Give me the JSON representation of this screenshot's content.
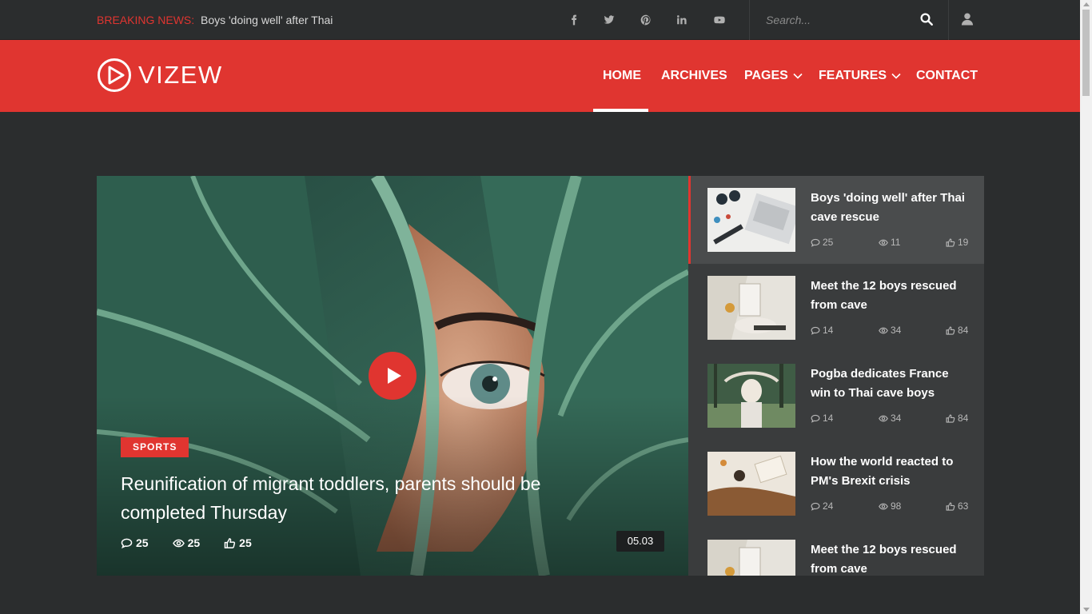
{
  "topbar": {
    "breaking_label": "BREAKING NEWS:",
    "breaking_text": "Boys 'doing well' after Thai",
    "social": [
      "facebook-icon",
      "twitter-icon",
      "pinterest-icon",
      "linkedin-icon",
      "youtube-icon"
    ],
    "search_placeholder": "Search..."
  },
  "header": {
    "logo_text": "VIZEW",
    "nav": {
      "home": "HOME",
      "archives": "ARCHIVES",
      "pages": "PAGES",
      "features": "FEATURES",
      "contact": "CONTACT"
    },
    "accent_color": "#e03530"
  },
  "hero": {
    "category": "SPORTS",
    "title": "Reunification of migrant toddlers, parents should be completed Thursday",
    "comments": "25",
    "views": "25",
    "likes": "25",
    "duration": "05.03"
  },
  "side_posts": [
    {
      "title": "Boys 'doing well' after Thai cave rescue",
      "comments": "25",
      "views": "11",
      "likes": "19"
    },
    {
      "title": "Meet the 12 boys rescued from cave",
      "comments": "14",
      "views": "34",
      "likes": "84"
    },
    {
      "title": "Pogba dedicates France win to Thai cave boys",
      "comments": "14",
      "views": "34",
      "likes": "84"
    },
    {
      "title": "How the world reacted to PM's Brexit crisis",
      "comments": "24",
      "views": "98",
      "likes": "63"
    },
    {
      "title": "Meet the 12 boys rescued from cave",
      "comments": "",
      "views": "",
      "likes": ""
    }
  ]
}
